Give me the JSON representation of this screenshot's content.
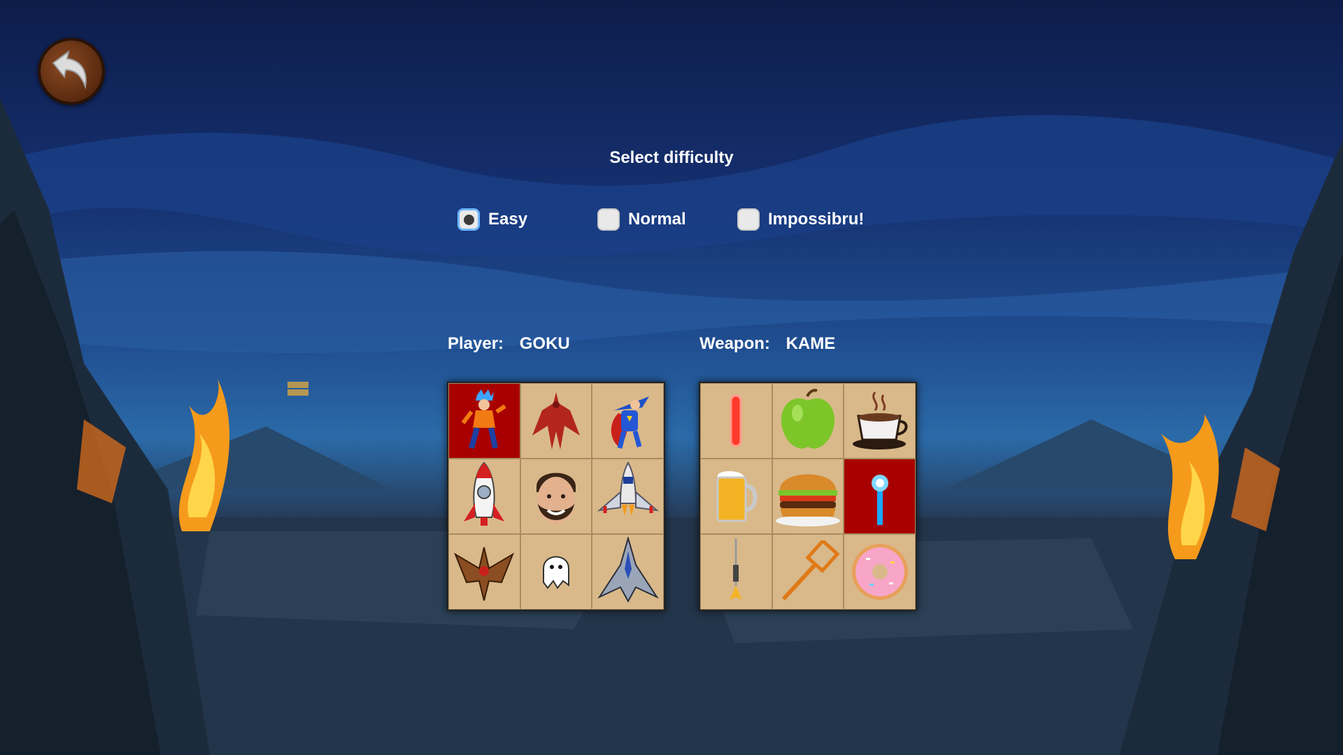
{
  "screen": {
    "title": "Select difficulty"
  },
  "back_button": {
    "icon": "back-arrow-icon"
  },
  "difficulty": {
    "options": [
      {
        "label": "Easy",
        "selected": true
      },
      {
        "label": "Normal",
        "selected": false
      },
      {
        "label": "Impossibru!",
        "selected": false
      }
    ]
  },
  "player": {
    "label": "Player:",
    "value": "GOKU"
  },
  "weapon": {
    "label": "Weapon:",
    "value": "KAME"
  },
  "player_grid": [
    {
      "icon": "goku-icon",
      "selected": true
    },
    {
      "icon": "red-demon-icon",
      "selected": false
    },
    {
      "icon": "superman-icon",
      "selected": false
    },
    {
      "icon": "rocket-icon",
      "selected": false
    },
    {
      "icon": "face-icon",
      "selected": false
    },
    {
      "icon": "space-shuttle-icon",
      "selected": false
    },
    {
      "icon": "bird-ship-icon",
      "selected": false
    },
    {
      "icon": "ghost-icon",
      "selected": false
    },
    {
      "icon": "starfighter-icon",
      "selected": false
    }
  ],
  "weapon_grid": [
    {
      "icon": "laser-icon",
      "selected": false
    },
    {
      "icon": "apple-icon",
      "selected": false
    },
    {
      "icon": "coffee-cup-icon",
      "selected": false
    },
    {
      "icon": "beer-mug-icon",
      "selected": false
    },
    {
      "icon": "burger-icon",
      "selected": false
    },
    {
      "icon": "kame-blast-icon",
      "selected": true
    },
    {
      "icon": "dart-icon",
      "selected": false
    },
    {
      "icon": "fly-swatter-icon",
      "selected": false
    },
    {
      "icon": "donut-icon",
      "selected": false
    }
  ]
}
